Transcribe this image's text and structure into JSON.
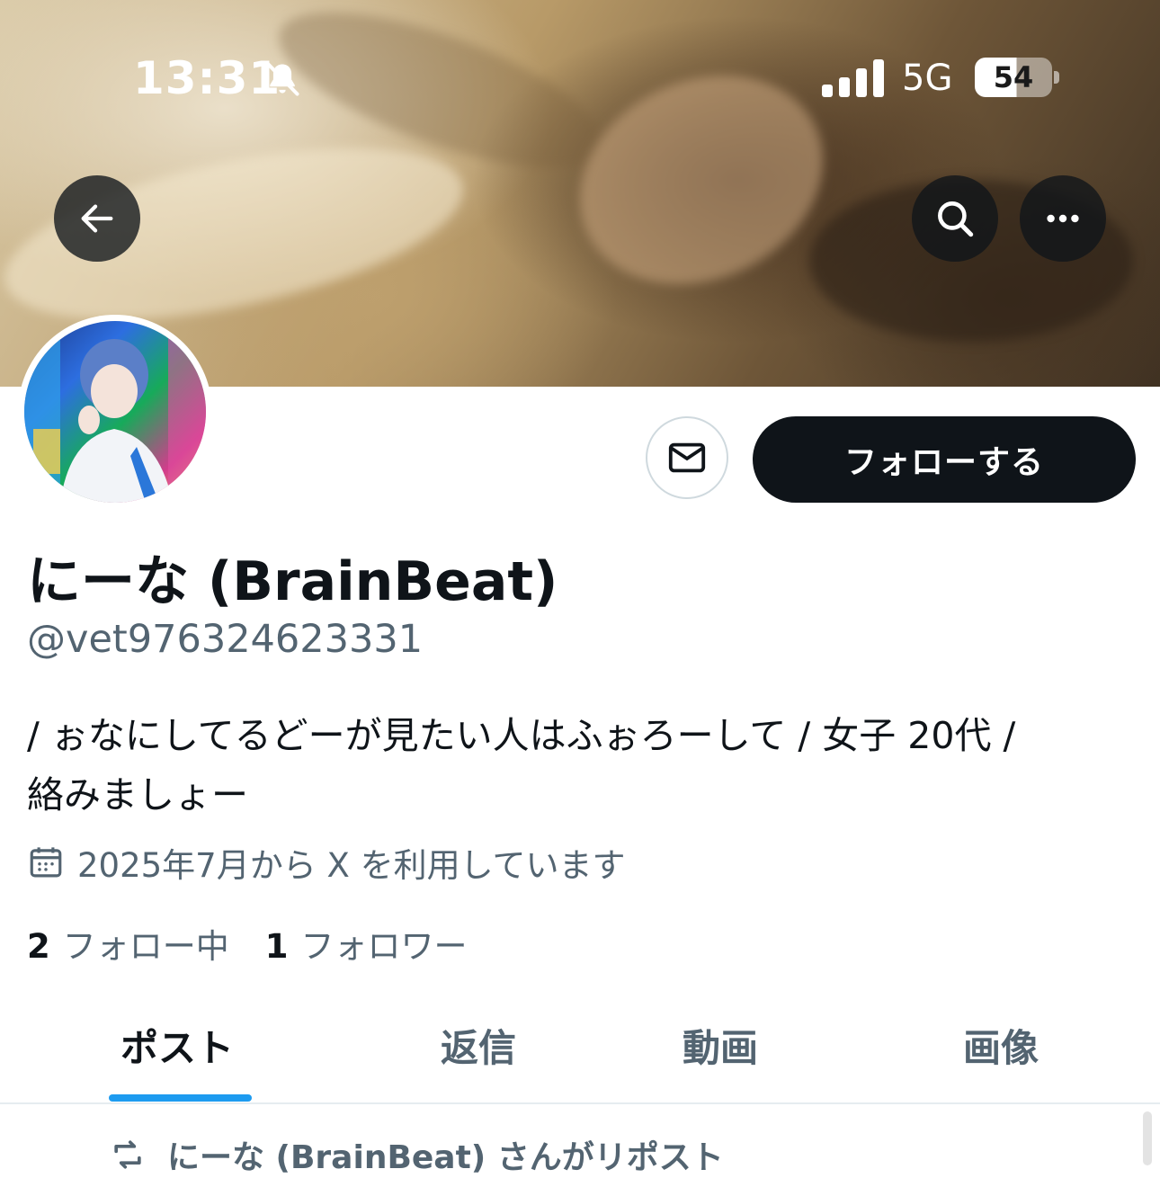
{
  "status_bar": {
    "time": "13:31",
    "network": "5G",
    "battery": "54",
    "battery_level": 0.54
  },
  "header": {
    "back_icon": "arrow-left-icon",
    "search_icon": "search-icon",
    "more_icon": "more-horizontal-icon"
  },
  "profile": {
    "name": "にーな (BrainBeat)",
    "handle": "@vet976324623331",
    "bio_line1": "/ ぉなにしてるどーが見たい人はふぉろーして / 女子 20代 /",
    "bio_line2": "絡みましょー",
    "joined": "2025年7月から X を利用しています",
    "following_count": "2",
    "following_label": "フォロー中",
    "followers_count": "1",
    "followers_label": "フォロワー"
  },
  "actions": {
    "message_icon": "mail-icon",
    "follow_label": "フォローする"
  },
  "tabs": [
    {
      "label": "ポスト",
      "active": true
    },
    {
      "label": "返信",
      "active": false
    },
    {
      "label": "動画",
      "active": false
    },
    {
      "label": "画像",
      "active": false
    }
  ],
  "feed": {
    "repost_notice": "にーな (BrainBeat) さんがリポスト"
  },
  "colors": {
    "accent": "#1d9bf0",
    "text_primary": "#0f1419",
    "text_secondary": "#536471",
    "button_dark": "#0f1419"
  }
}
